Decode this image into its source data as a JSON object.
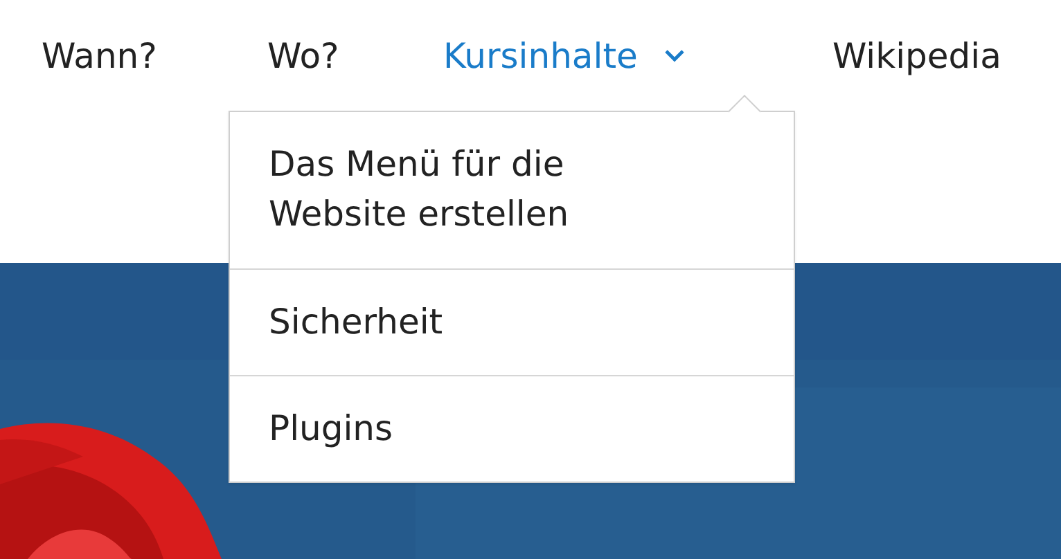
{
  "nav": [
    {
      "label": "Wann?",
      "selected": false,
      "has_dropdown": false
    },
    {
      "label": "Wo?",
      "selected": false,
      "has_dropdown": false
    },
    {
      "label": "Kursinhalte",
      "selected": true,
      "has_dropdown": true
    },
    {
      "label": "Wikipedia",
      "selected": false,
      "has_dropdown": false
    }
  ],
  "dropdown": {
    "items": [
      {
        "label": "Das Menü für die Website erstellen"
      },
      {
        "label": "Sicherheit"
      },
      {
        "label": "Plugins"
      }
    ]
  }
}
